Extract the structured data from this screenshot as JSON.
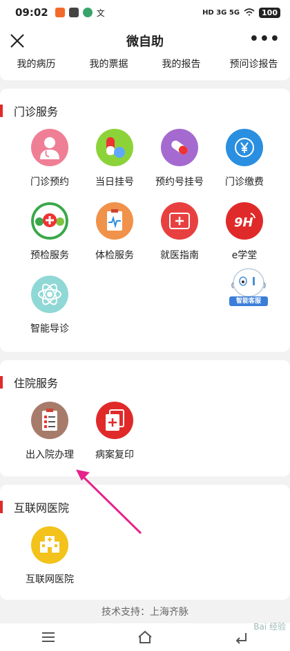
{
  "status_bar": {
    "time": "09:02",
    "network": "HD 3G 5G",
    "battery": "100"
  },
  "header": {
    "title": "微自助"
  },
  "top_links": [
    "我的病历",
    "我的票据",
    "我的报告",
    "预问诊报告"
  ],
  "outpatient": {
    "title": "门诊服务",
    "items": [
      {
        "label": "门诊预约",
        "icon": "doctor-icon",
        "color": "#ef7f95"
      },
      {
        "label": "当日挂号",
        "icon": "pills-icon",
        "color": "#8cd33a"
      },
      {
        "label": "预约号挂号",
        "icon": "capsule-icon",
        "color": "#a46ad0"
      },
      {
        "label": "门诊缴费",
        "icon": "yen-icon",
        "color": "#2a8fe0"
      },
      {
        "label": "预检服务",
        "icon": "medical-cross-icon",
        "color": "#39a84a"
      },
      {
        "label": "体检服务",
        "icon": "clipboard-pulse-icon",
        "color": "#f0924a"
      },
      {
        "label": "就医指南",
        "icon": "first-aid-icon",
        "color": "#e84040"
      },
      {
        "label": "e学堂",
        "icon": "9h-logo-icon",
        "color": "#e02a2a"
      },
      {
        "label": "智能导诊",
        "icon": "atom-icon",
        "color": "#8fd8d6"
      }
    ]
  },
  "inpatient": {
    "title": "住院服务",
    "items": [
      {
        "label": "出入院办理",
        "icon": "checklist-icon",
        "color": "#a77b6a"
      },
      {
        "label": "病案复印",
        "icon": "copy-files-icon",
        "color": "#e02a2a"
      }
    ]
  },
  "internet_hospital": {
    "title": "互联网医院",
    "items": [
      {
        "label": "互联网医院",
        "icon": "hospital-icon",
        "color": "#f3c21b"
      }
    ]
  },
  "assistant": {
    "label": "智能客服"
  },
  "footer": {
    "text": "技术支持：上海齐脉"
  },
  "watermark": {
    "text": "Bai 经验"
  }
}
